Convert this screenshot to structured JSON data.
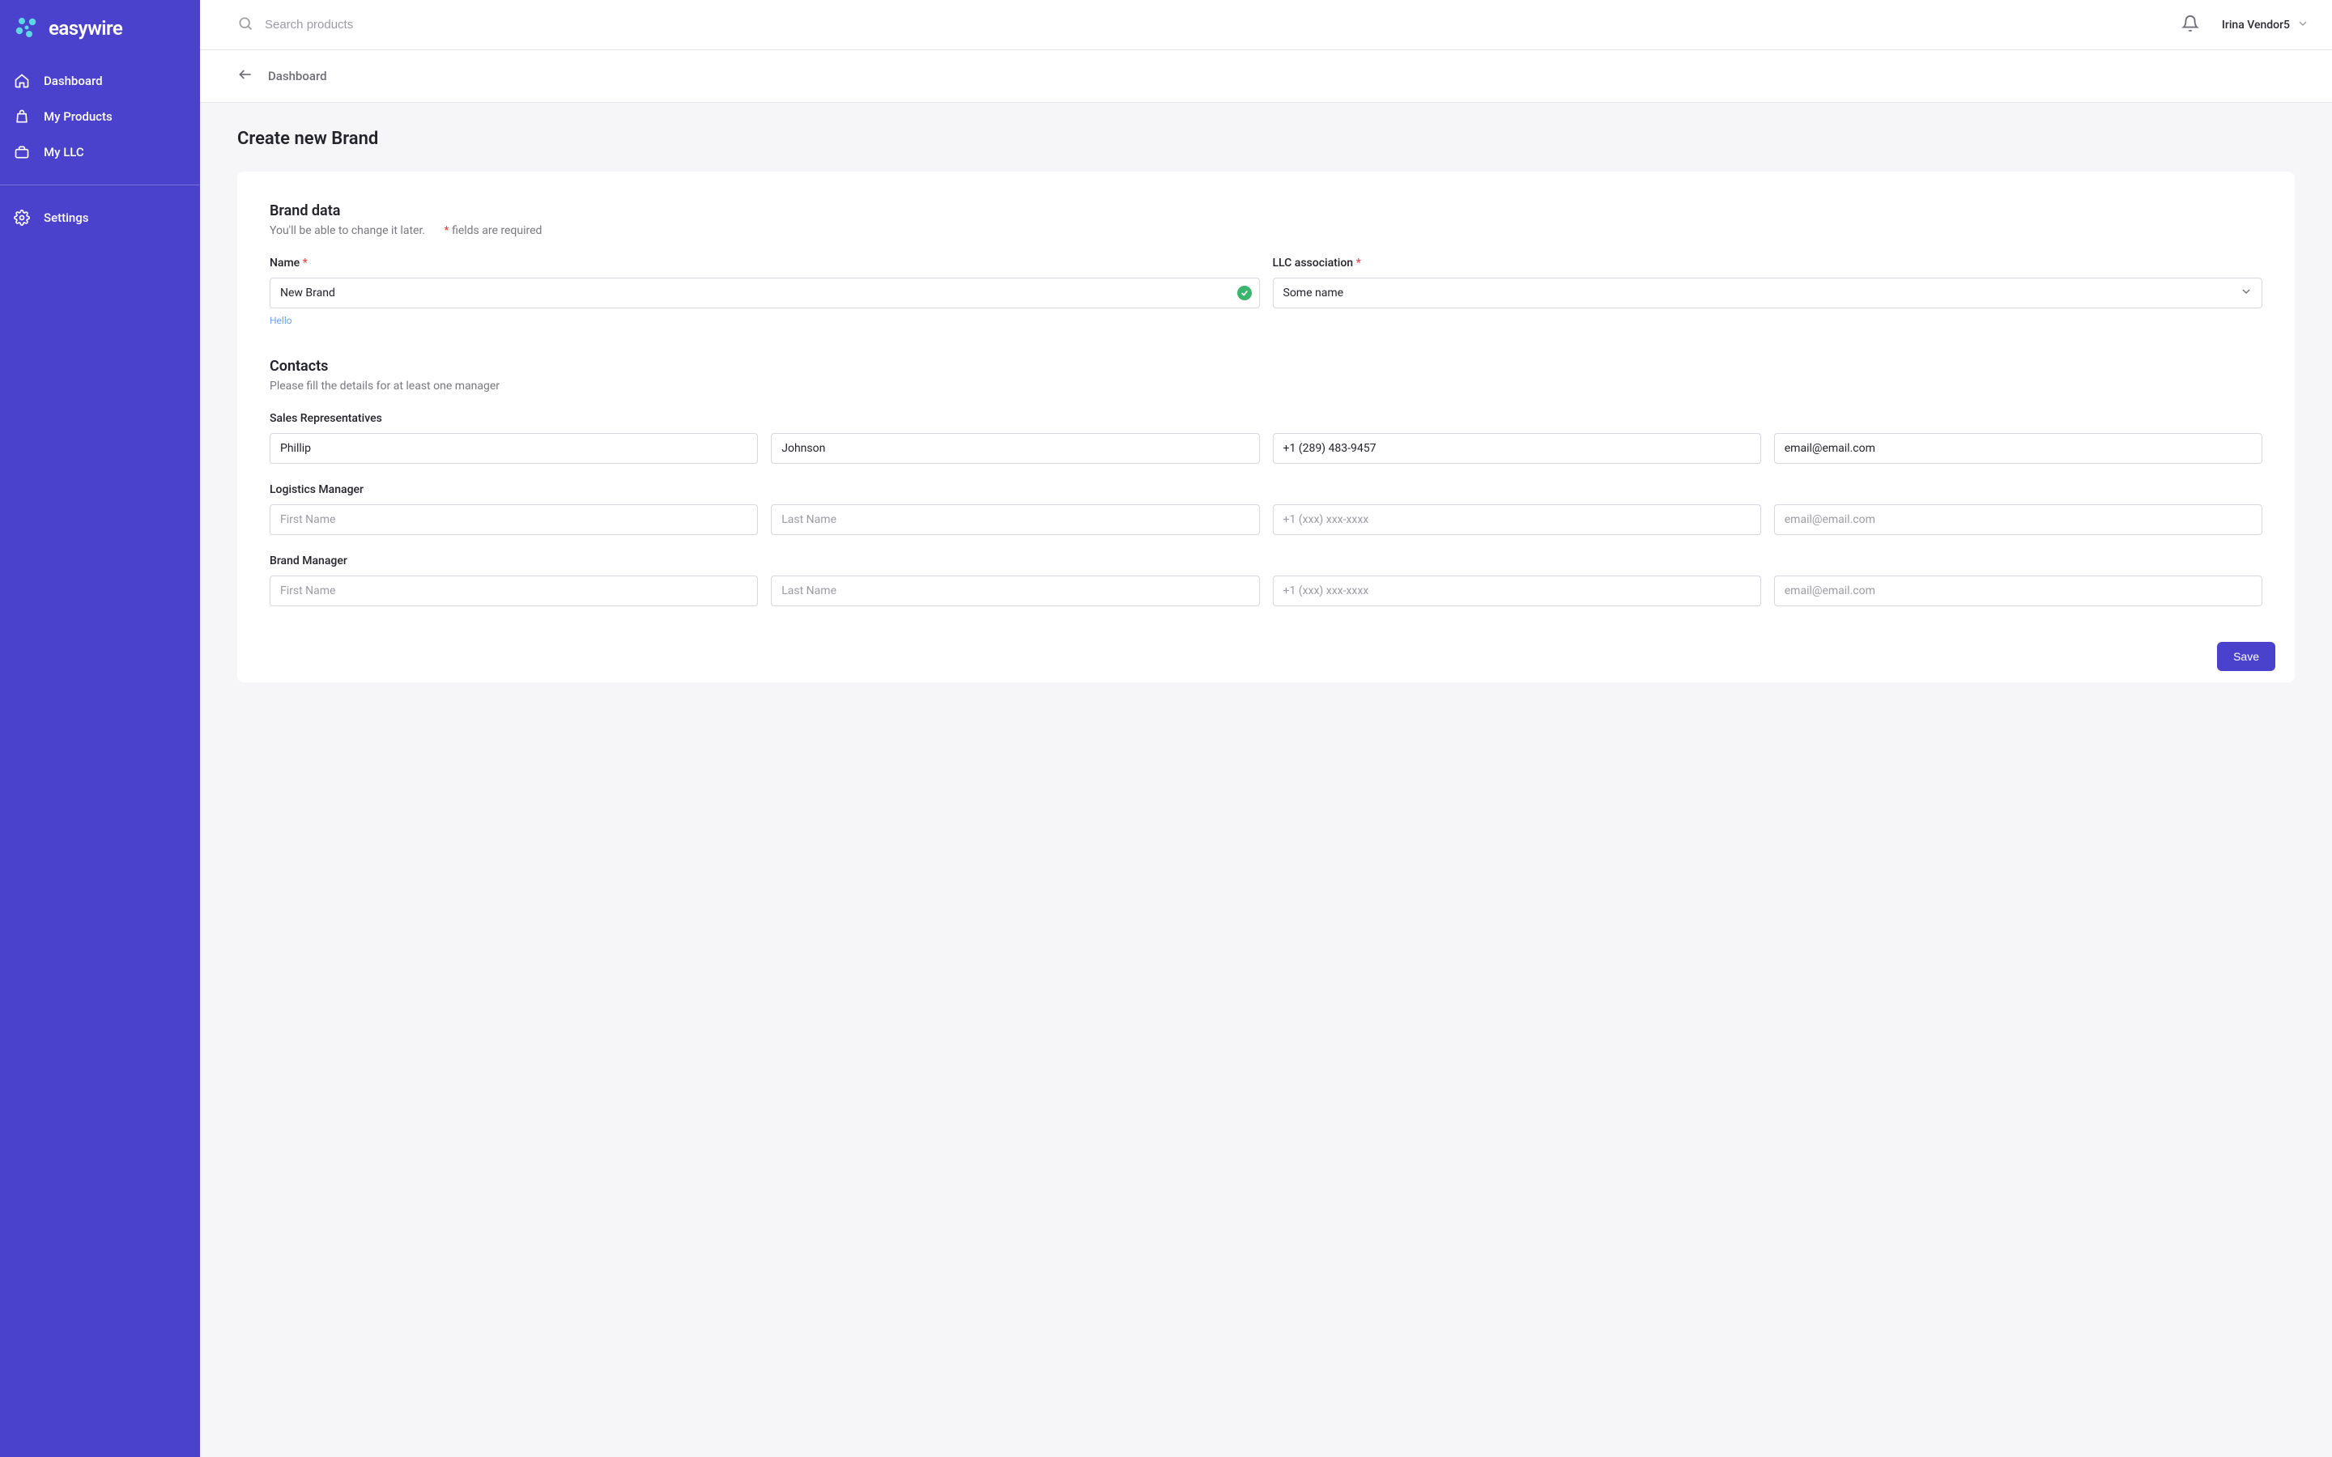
{
  "brand": {
    "name": "easywire"
  },
  "sidebar": {
    "items": [
      {
        "label": "Dashboard"
      },
      {
        "label": "My Products"
      },
      {
        "label": "My LLC"
      }
    ],
    "settings_label": "Settings"
  },
  "topbar": {
    "search_placeholder": "Search products",
    "user_name": "Irina Vendor5"
  },
  "breadcrumb": {
    "label": "Dashboard"
  },
  "page": {
    "title": "Create new Brand"
  },
  "form": {
    "brand_section_title": "Brand data",
    "brand_section_sub": "You'll be able to change it later.",
    "required_note": "fields are required",
    "name_label": "Name",
    "name_value": "New Brand",
    "name_helper": "Hello",
    "llc_label": "LLC association",
    "llc_value": "Some name",
    "contacts_title": "Contacts",
    "contacts_sub": "Please fill the details for at least one manager",
    "placeholders": {
      "first_name": "First Name",
      "last_name": "Last Name",
      "phone": "+1 (xxx) xxx-xxxx",
      "email": "email@email.com"
    },
    "roles": {
      "sales": {
        "label": "Sales Representatives",
        "first_name": "Phillip",
        "last_name": "Johnson",
        "phone": "+1 (289) 483-9457",
        "email": "email@email.com"
      },
      "logistics": {
        "label": "Logistics Manager"
      },
      "brand_mgr": {
        "label": "Brand Manager"
      }
    },
    "save_label": "Save"
  }
}
